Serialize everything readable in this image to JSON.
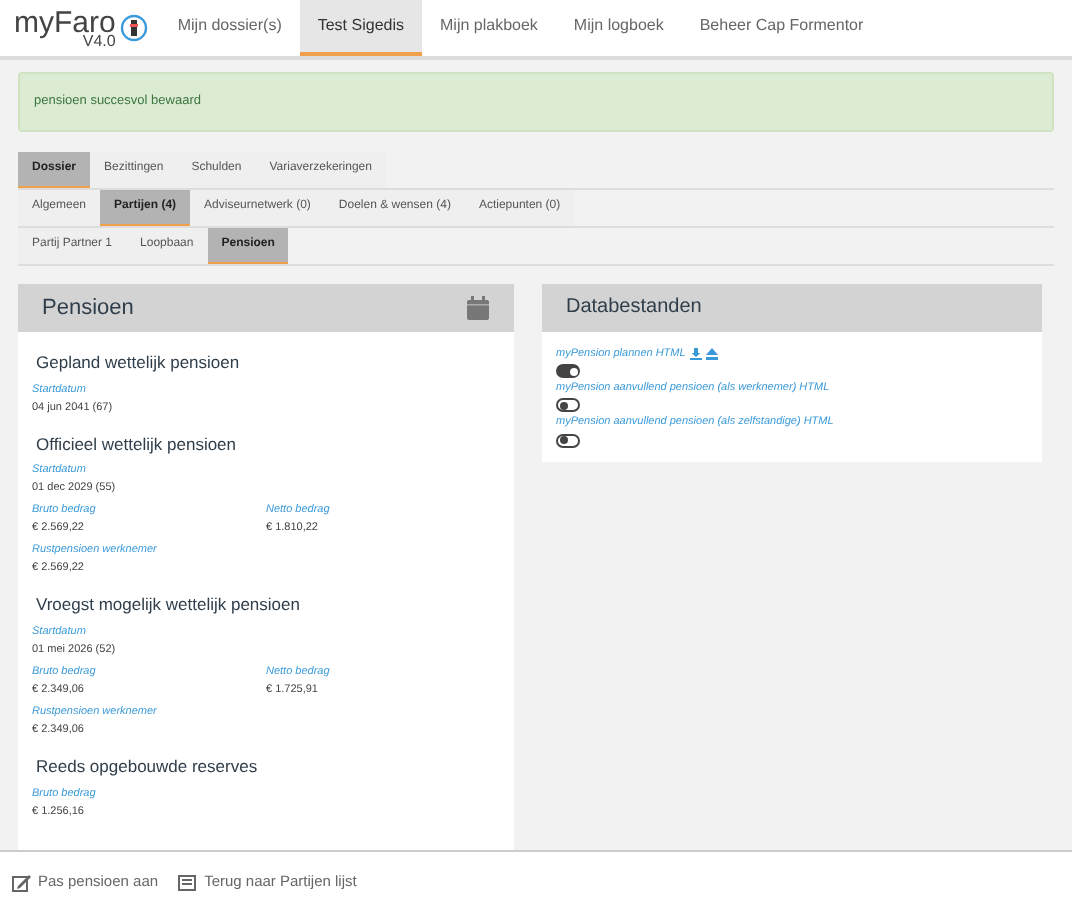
{
  "logo": {
    "name": "myFaro",
    "version": "V4.0"
  },
  "nav": [
    {
      "label": "Mijn dossier(s)",
      "selected": false
    },
    {
      "label": "Test Sigedis",
      "selected": true
    },
    {
      "label": "Mijn plakboek",
      "selected": false
    },
    {
      "label": "Mijn logboek",
      "selected": false
    },
    {
      "label": "Beheer Cap Formentor",
      "selected": false
    }
  ],
  "alert": "pensioen succesvol bewaard",
  "tab_rows": [
    [
      {
        "label": "Dossier",
        "selected": true
      },
      {
        "label": "Bezittingen",
        "selected": false
      },
      {
        "label": "Schulden",
        "selected": false
      },
      {
        "label": "Variaverzekeringen",
        "selected": false
      }
    ],
    [
      {
        "label": "Algemeen",
        "selected": false
      },
      {
        "label": "Partijen (4)",
        "selected": true
      },
      {
        "label": "Adviseurnetwerk (0)",
        "selected": false
      },
      {
        "label": "Doelen & wensen (4)",
        "selected": false
      },
      {
        "label": "Actiepunten (0)",
        "selected": false
      }
    ],
    [
      {
        "label": "Partij Partner 1",
        "selected": false
      },
      {
        "label": "Loopbaan",
        "selected": false
      },
      {
        "label": "Pensioen",
        "selected": true
      }
    ]
  ],
  "pension_panel": {
    "title": "Pensioen",
    "sections": [
      {
        "title": "Gepland wettelijk pensioen",
        "rows": [
          [
            {
              "label": "Startdatum",
              "value": "04 jun 2041 (67)"
            }
          ]
        ]
      },
      {
        "title": "Officieel wettelijk pensioen",
        "rows": [
          [
            {
              "label": "Startdatum",
              "value": "01 dec 2029 (55)"
            }
          ],
          [
            {
              "label": "Bruto bedrag",
              "value": "€ 2.569,22"
            },
            {
              "label": "Netto bedrag",
              "value": "€ 1.810,22"
            }
          ],
          [
            {
              "label": "Rustpensioen werknemer",
              "value": "€ 2.569,22"
            }
          ]
        ]
      },
      {
        "title": "Vroegst mogelijk wettelijk pensioen",
        "rows": [
          [
            {
              "label": "Startdatum",
              "value": "01 mei 2026 (52)"
            }
          ],
          [
            {
              "label": "Bruto bedrag",
              "value": "€ 2.349,06"
            },
            {
              "label": "Netto bedrag",
              "value": "€ 1.725,91"
            }
          ],
          [
            {
              "label": "Rustpensioen werknemer",
              "value": "€ 2.349,06"
            }
          ]
        ]
      },
      {
        "title": "Reeds opgebouwde reserves",
        "rows": [
          [
            {
              "label": "Bruto bedrag",
              "value": "€ 1.256,16"
            }
          ]
        ]
      }
    ]
  },
  "data_panel": {
    "title": "Databestanden",
    "files": [
      {
        "label": "myPension plannen HTML",
        "actions": true,
        "on": true
      },
      {
        "label": "myPension aanvullend pensioen (als werknemer) HTML",
        "actions": false,
        "on": false
      },
      {
        "label": "myPension aanvullend pensioen (als zelfstandige) HTML",
        "actions": false,
        "on": false
      }
    ]
  },
  "footer": [
    "Pas pensioen aan",
    "Terug naar Partijen lijst"
  ]
}
